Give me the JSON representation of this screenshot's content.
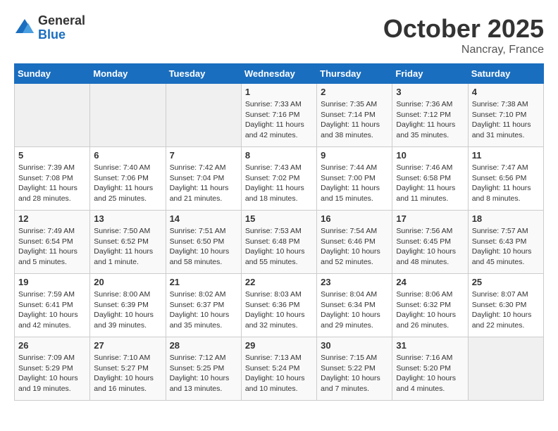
{
  "header": {
    "logo_general": "General",
    "logo_blue": "Blue",
    "month": "October 2025",
    "location": "Nancray, France"
  },
  "days_of_week": [
    "Sunday",
    "Monday",
    "Tuesday",
    "Wednesday",
    "Thursday",
    "Friday",
    "Saturday"
  ],
  "weeks": [
    [
      {
        "day": "",
        "info": ""
      },
      {
        "day": "",
        "info": ""
      },
      {
        "day": "",
        "info": ""
      },
      {
        "day": "1",
        "info": "Sunrise: 7:33 AM\nSunset: 7:16 PM\nDaylight: 11 hours and 42 minutes."
      },
      {
        "day": "2",
        "info": "Sunrise: 7:35 AM\nSunset: 7:14 PM\nDaylight: 11 hours and 38 minutes."
      },
      {
        "day": "3",
        "info": "Sunrise: 7:36 AM\nSunset: 7:12 PM\nDaylight: 11 hours and 35 minutes."
      },
      {
        "day": "4",
        "info": "Sunrise: 7:38 AM\nSunset: 7:10 PM\nDaylight: 11 hours and 31 minutes."
      }
    ],
    [
      {
        "day": "5",
        "info": "Sunrise: 7:39 AM\nSunset: 7:08 PM\nDaylight: 11 hours and 28 minutes."
      },
      {
        "day": "6",
        "info": "Sunrise: 7:40 AM\nSunset: 7:06 PM\nDaylight: 11 hours and 25 minutes."
      },
      {
        "day": "7",
        "info": "Sunrise: 7:42 AM\nSunset: 7:04 PM\nDaylight: 11 hours and 21 minutes."
      },
      {
        "day": "8",
        "info": "Sunrise: 7:43 AM\nSunset: 7:02 PM\nDaylight: 11 hours and 18 minutes."
      },
      {
        "day": "9",
        "info": "Sunrise: 7:44 AM\nSunset: 7:00 PM\nDaylight: 11 hours and 15 minutes."
      },
      {
        "day": "10",
        "info": "Sunrise: 7:46 AM\nSunset: 6:58 PM\nDaylight: 11 hours and 11 minutes."
      },
      {
        "day": "11",
        "info": "Sunrise: 7:47 AM\nSunset: 6:56 PM\nDaylight: 11 hours and 8 minutes."
      }
    ],
    [
      {
        "day": "12",
        "info": "Sunrise: 7:49 AM\nSunset: 6:54 PM\nDaylight: 11 hours and 5 minutes."
      },
      {
        "day": "13",
        "info": "Sunrise: 7:50 AM\nSunset: 6:52 PM\nDaylight: 11 hours and 1 minute."
      },
      {
        "day": "14",
        "info": "Sunrise: 7:51 AM\nSunset: 6:50 PM\nDaylight: 10 hours and 58 minutes."
      },
      {
        "day": "15",
        "info": "Sunrise: 7:53 AM\nSunset: 6:48 PM\nDaylight: 10 hours and 55 minutes."
      },
      {
        "day": "16",
        "info": "Sunrise: 7:54 AM\nSunset: 6:46 PM\nDaylight: 10 hours and 52 minutes."
      },
      {
        "day": "17",
        "info": "Sunrise: 7:56 AM\nSunset: 6:45 PM\nDaylight: 10 hours and 48 minutes."
      },
      {
        "day": "18",
        "info": "Sunrise: 7:57 AM\nSunset: 6:43 PM\nDaylight: 10 hours and 45 minutes."
      }
    ],
    [
      {
        "day": "19",
        "info": "Sunrise: 7:59 AM\nSunset: 6:41 PM\nDaylight: 10 hours and 42 minutes."
      },
      {
        "day": "20",
        "info": "Sunrise: 8:00 AM\nSunset: 6:39 PM\nDaylight: 10 hours and 39 minutes."
      },
      {
        "day": "21",
        "info": "Sunrise: 8:02 AM\nSunset: 6:37 PM\nDaylight: 10 hours and 35 minutes."
      },
      {
        "day": "22",
        "info": "Sunrise: 8:03 AM\nSunset: 6:36 PM\nDaylight: 10 hours and 32 minutes."
      },
      {
        "day": "23",
        "info": "Sunrise: 8:04 AM\nSunset: 6:34 PM\nDaylight: 10 hours and 29 minutes."
      },
      {
        "day": "24",
        "info": "Sunrise: 8:06 AM\nSunset: 6:32 PM\nDaylight: 10 hours and 26 minutes."
      },
      {
        "day": "25",
        "info": "Sunrise: 8:07 AM\nSunset: 6:30 PM\nDaylight: 10 hours and 22 minutes."
      }
    ],
    [
      {
        "day": "26",
        "info": "Sunrise: 7:09 AM\nSunset: 5:29 PM\nDaylight: 10 hours and 19 minutes."
      },
      {
        "day": "27",
        "info": "Sunrise: 7:10 AM\nSunset: 5:27 PM\nDaylight: 10 hours and 16 minutes."
      },
      {
        "day": "28",
        "info": "Sunrise: 7:12 AM\nSunset: 5:25 PM\nDaylight: 10 hours and 13 minutes."
      },
      {
        "day": "29",
        "info": "Sunrise: 7:13 AM\nSunset: 5:24 PM\nDaylight: 10 hours and 10 minutes."
      },
      {
        "day": "30",
        "info": "Sunrise: 7:15 AM\nSunset: 5:22 PM\nDaylight: 10 hours and 7 minutes."
      },
      {
        "day": "31",
        "info": "Sunrise: 7:16 AM\nSunset: 5:20 PM\nDaylight: 10 hours and 4 minutes."
      },
      {
        "day": "",
        "info": ""
      }
    ]
  ]
}
